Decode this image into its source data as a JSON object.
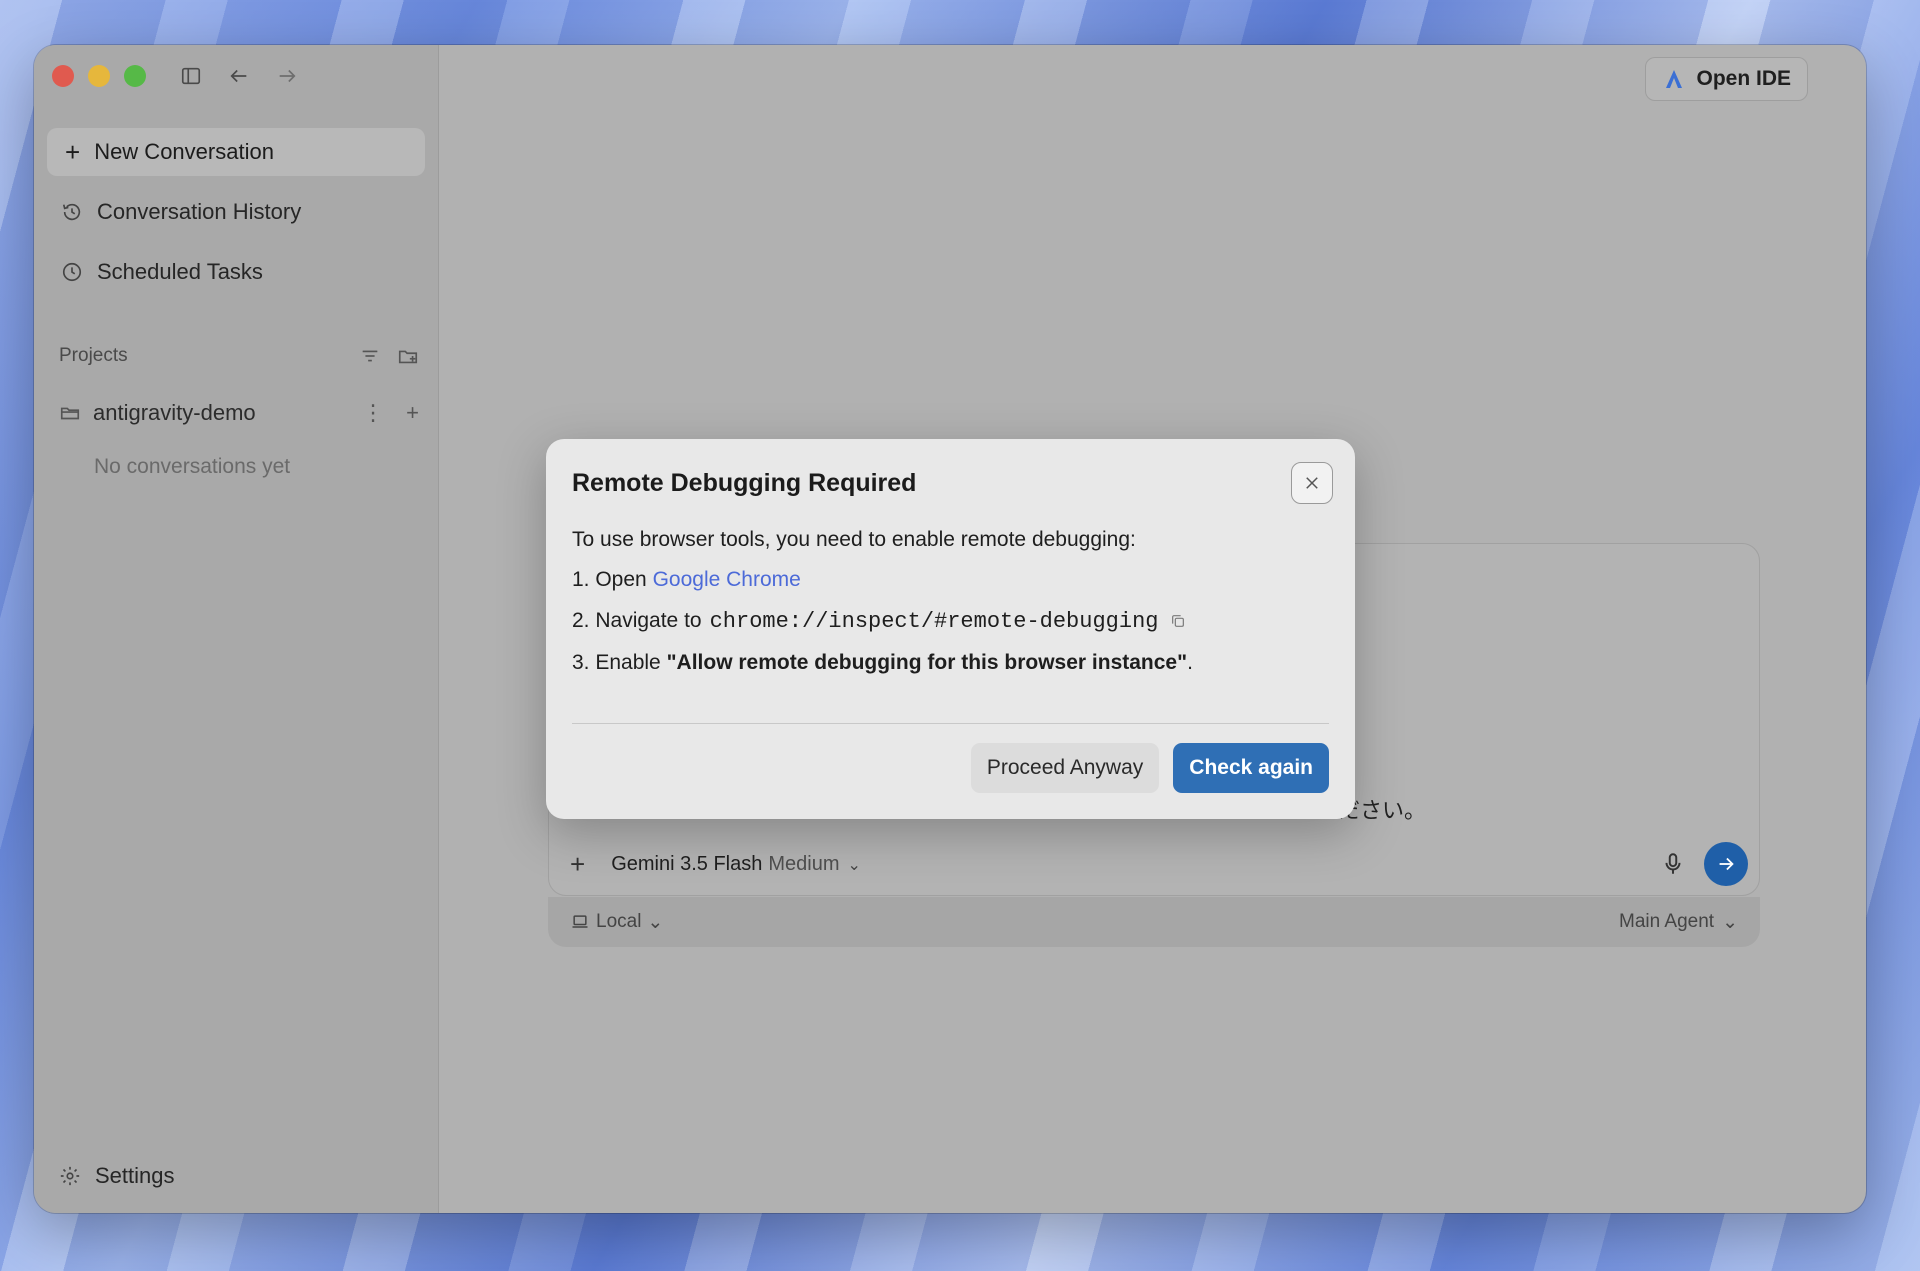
{
  "sidebar": {
    "new_conversation": "New Conversation",
    "conversation_history": "Conversation History",
    "scheduled_tasks": "Scheduled Tasks",
    "projects_label": "Projects",
    "project_name": "antigravity-demo",
    "empty_note": "No conversations yet",
    "settings": "Settings"
  },
  "header": {
    "open_ide": "Open IDE"
  },
  "composer": {
    "partial_text": "ださい。",
    "model_name": "Gemini 3.5 Flash",
    "model_mode": "Medium",
    "environment": "Local",
    "agent": "Main Agent"
  },
  "modal": {
    "title": "Remote Debugging Required",
    "intro": "To use browser tools, you need to enable remote debugging:",
    "step1_prefix": "1. Open",
    "step1_link": "Google Chrome",
    "step2_prefix": "2. Navigate to",
    "step2_code": "chrome://inspect/#remote-debugging",
    "step3_prefix": "3. Enable",
    "step3_bold": "\"Allow remote debugging for this browser instance\"",
    "step3_suffix": ".",
    "proceed": "Proceed Anyway",
    "check_again": "Check again"
  },
  "colors": {
    "primary": "#2f6fb5",
    "link": "#4c6ad8",
    "send": "#1f5fa8"
  }
}
